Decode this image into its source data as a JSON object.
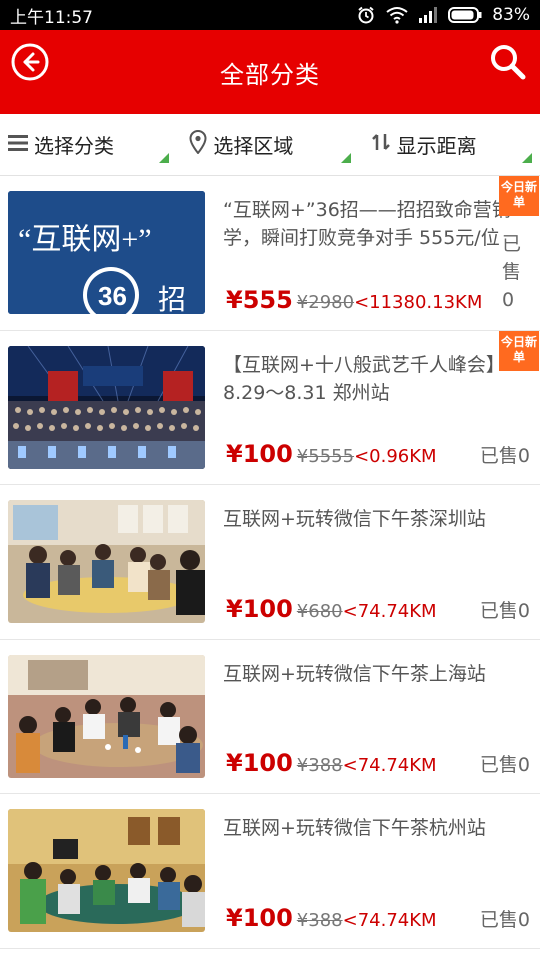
{
  "status": {
    "time": "上午11:57",
    "battery": "83%"
  },
  "header": {
    "title": "全部分类"
  },
  "filters": [
    {
      "label": "选择分类",
      "icon": "menu-icon"
    },
    {
      "label": "选择区域",
      "icon": "location-pin-icon"
    },
    {
      "label": "显示距离",
      "icon": "sort-arrows-icon"
    }
  ],
  "items": [
    {
      "title": "“互联网+”36招——招招致命营销学，瞬间打败竞争对手 555元/位",
      "price": "¥555",
      "original_price": "¥2980",
      "distance": "<11380.13KM",
      "sold": "已售0",
      "badge": "今日新单",
      "thumb_text_1": "“互联网+”",
      "thumb_text_2": "36",
      "thumb_text_3": "招"
    },
    {
      "title": "【互联网+十八般武艺千人峰会】8.29～8.31 郑州站",
      "price": "¥100",
      "original_price": "¥5555",
      "distance": "<0.96KM",
      "sold": "已售0",
      "badge": "今日新单"
    },
    {
      "title": "互联网+玩转微信下午茶深圳站",
      "price": "¥100",
      "original_price": "¥680",
      "distance": "<74.74KM",
      "sold": "已售0"
    },
    {
      "title": "互联网+玩转微信下午茶上海站",
      "price": "¥100",
      "original_price": "¥388",
      "distance": "<74.74KM",
      "sold": "已售0"
    },
    {
      "title": "互联网+玩转微信下午茶杭州站",
      "price": "¥100",
      "original_price": "¥388",
      "distance": "<74.74KM",
      "sold": "已售0"
    }
  ],
  "colors": {
    "brand_red": "#e60000",
    "price_red": "#cc0000",
    "badge_orange": "#ff6a1f",
    "filter_triangle_green": "#4cae4c"
  }
}
